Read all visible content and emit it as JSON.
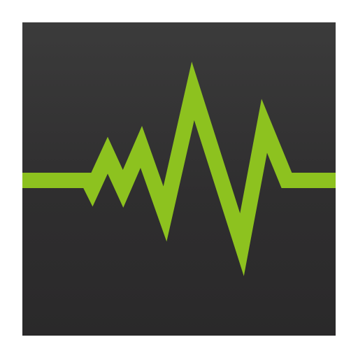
{
  "icon": {
    "name": "waveform-icon",
    "background_color": "#333233",
    "line_color": "#8dc21f"
  }
}
